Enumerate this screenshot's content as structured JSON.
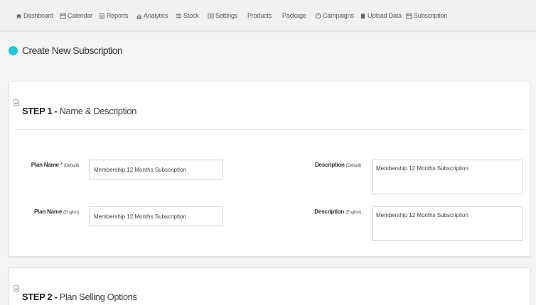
{
  "nav": {
    "items": [
      {
        "label": "Dashboard",
        "icon": "home-icon"
      },
      {
        "label": "Calendar",
        "icon": "calendar-icon"
      },
      {
        "label": "Reports",
        "icon": "document-icon"
      },
      {
        "label": "Analytics",
        "icon": "bar-chart-icon"
      },
      {
        "label": "Stock",
        "icon": "list-icon"
      },
      {
        "label": "Settings",
        "icon": "settings-icon"
      },
      {
        "label": "Products",
        "icon": ""
      },
      {
        "label": "Package",
        "icon": ""
      },
      {
        "label": "Campaigns",
        "icon": "clock-icon"
      },
      {
        "label": "Upload Data",
        "icon": "database-icon"
      },
      {
        "label": "Subscription",
        "icon": "calendar-icon"
      }
    ]
  },
  "page": {
    "title": "Create New Subscription",
    "accent_color": "#1fc7d4"
  },
  "step1": {
    "step_label": "STEP 1",
    "separator": "-",
    "title": "Name & Description",
    "fields": {
      "plan_name_default": {
        "label": "Plan Name",
        "required_mark": "*",
        "lang": "(Default)",
        "value": "Membership 12 Months Subscription"
      },
      "plan_name_english": {
        "label": "Plan Name",
        "lang": "(English)",
        "value": "Membership 12 Months Subscription"
      },
      "description_default": {
        "label": "Description",
        "lang": "(Default)",
        "value": "Membership 12 Months Subscription"
      },
      "description_english": {
        "label": "Description",
        "lang": "(English)",
        "value": "Membership 12 Months Subscription"
      }
    }
  },
  "step2": {
    "step_label": "STEP 2",
    "separator": "-",
    "title": "Plan Selling Options"
  }
}
